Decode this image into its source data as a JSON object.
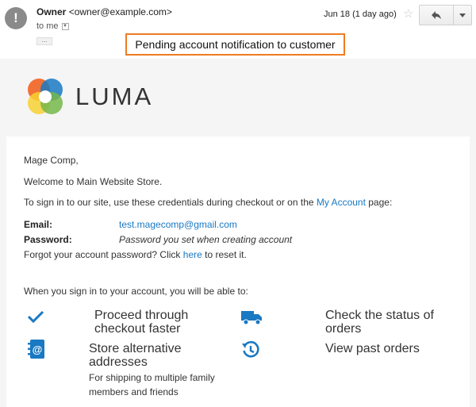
{
  "header": {
    "avatar_glyph": "!",
    "sender_name": "Owner",
    "sender_email": "<owner@example.com>",
    "recipient": "to me",
    "dots": "...",
    "date": "Jun 18 (1 day ago)",
    "callout": "Pending account notification to customer"
  },
  "brand": {
    "logo_text": "LUMA",
    "colors": [
      "#f26322",
      "#1979c3",
      "#75b74b",
      "#f7d131"
    ]
  },
  "email": {
    "greeting": "Mage Comp,",
    "welcome": "Welcome to Main Website Store.",
    "signin_pre": "To sign in to our site, use these credentials during checkout or on the ",
    "signin_link": "My Account",
    "signin_post": " page:",
    "email_label": "Email:",
    "email_value": "test.magecomp@gmail.com",
    "password_label": "Password:",
    "password_value": "Password you set when creating account",
    "forgot_pre": "Forgot your account password? Click ",
    "forgot_link": "here",
    "forgot_post": " to reset it.",
    "benefits_intro": "When you sign in to your account, you will be able to:",
    "features": {
      "checkout_line1": "Proceed through",
      "checkout_line2": "checkout faster",
      "status_line1": "Check the status of",
      "status_line2": "orders",
      "address_line1": "Store alternative",
      "address_line2": "addresses",
      "address_sub1": "For shipping to multiple family",
      "address_sub2": "members and friends",
      "past_orders": "View past orders"
    },
    "icons": [
      "checkmark-icon",
      "truck-icon",
      "address-book-icon",
      "history-icon"
    ],
    "accent_color": "#1979c3"
  }
}
